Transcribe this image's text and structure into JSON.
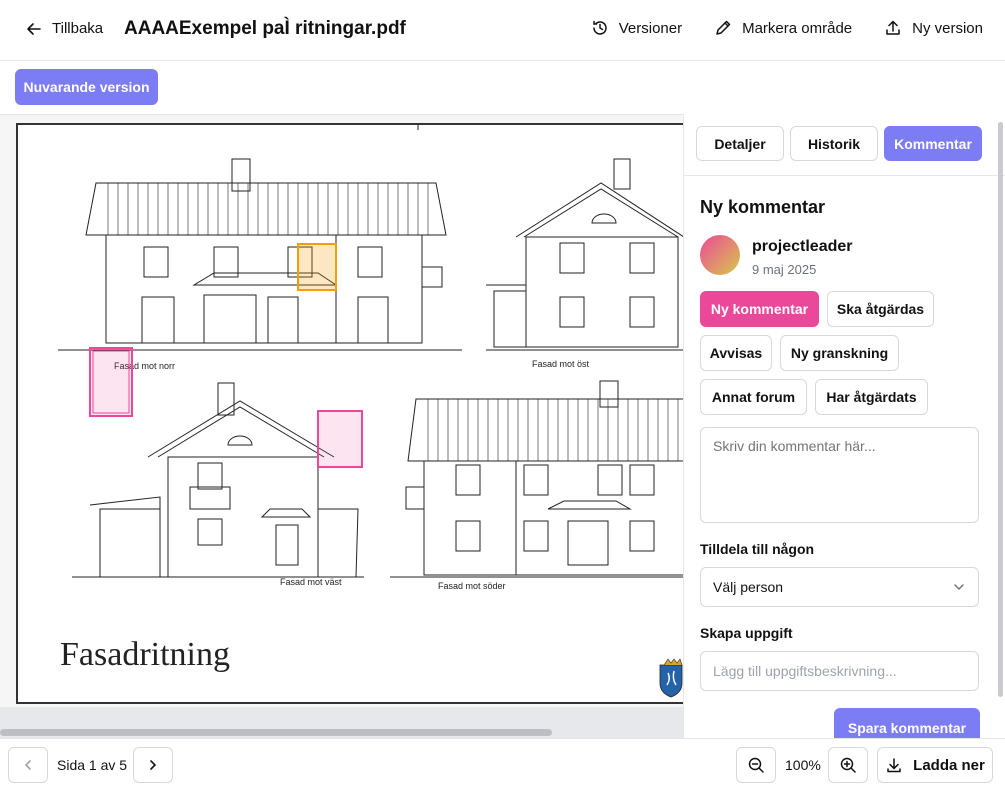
{
  "header": {
    "back_label": "Tillbaka",
    "doc_title": "AAAAExempel paÌ ritningar.pdf",
    "actions": [
      {
        "label": "Versioner",
        "icon": "history-icon"
      },
      {
        "label": "Markera område",
        "icon": "pencil-icon"
      },
      {
        "label": "Ny version",
        "icon": "upload-icon"
      }
    ]
  },
  "version_button": "Nuvarande version",
  "drawing": {
    "title": "Fasadritning",
    "captions": [
      "Fasad mot norr",
      "Fasad mot öst",
      "Fasad mot väst",
      "Fasad mot söder"
    ],
    "markup_colors": {
      "pink": "#ec4899",
      "orange": "#f59e0b"
    }
  },
  "panel": {
    "tabs": [
      "Detaljer",
      "Historik",
      "Kommentar"
    ],
    "active_tab": "Kommentar",
    "section_title": "Ny kommentar",
    "user": {
      "name": "projectleader",
      "date": "9 maj 2025"
    },
    "categories": [
      "Ny kommentar",
      "Ska åtgärdas",
      "Avvisas",
      "Ny granskning",
      "Annat forum",
      "Har åtgärdats"
    ],
    "active_category": "Ny kommentar",
    "comment_placeholder": "Skriv din kommentar här...",
    "assign_label": "Tilldela till någon",
    "assign_value": "Välj person",
    "task_label": "Skapa uppgift",
    "task_placeholder": "Lägg till uppgiftsbeskrivning...",
    "save_label": "Spara kommentar"
  },
  "footer": {
    "page_text": "Sida 1 av 5",
    "zoom": "100%",
    "download_label": "Ladda ner"
  },
  "colors": {
    "accent": "#7c7cf5",
    "pink": "#ec4899"
  }
}
